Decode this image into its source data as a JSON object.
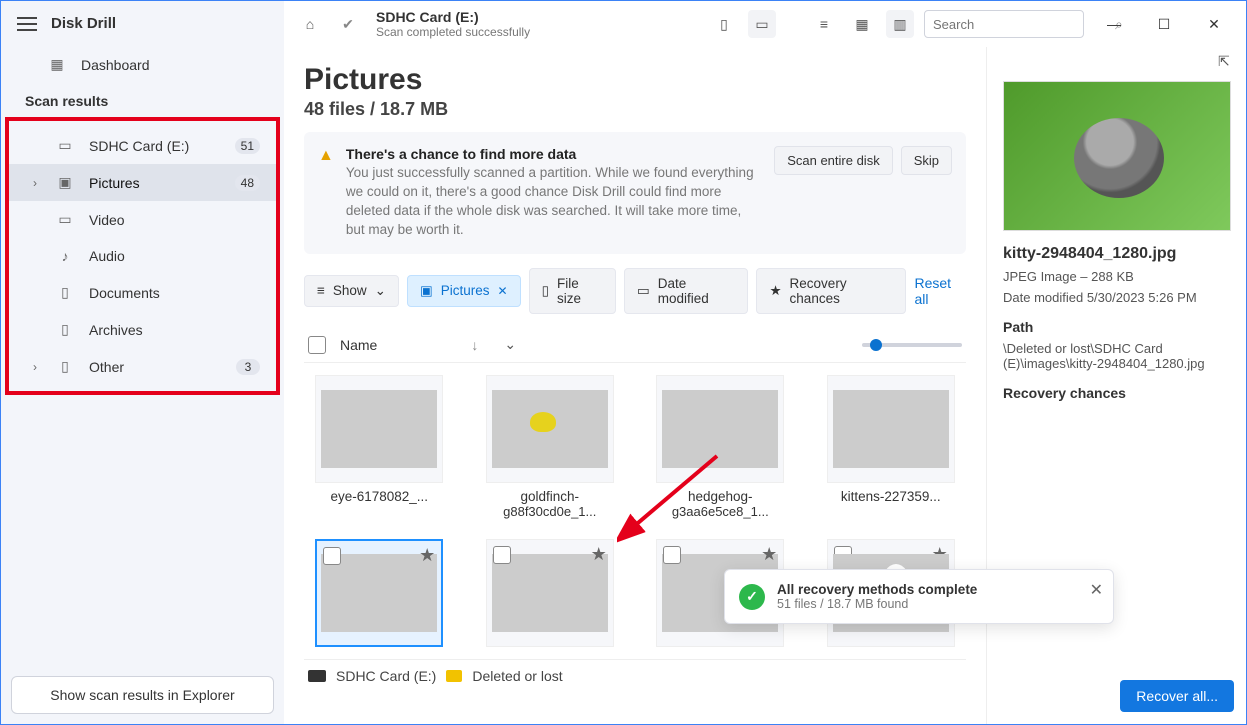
{
  "app": {
    "name": "Disk Drill"
  },
  "sidebar": {
    "dashboard": "Dashboard",
    "section": "Scan results",
    "items": [
      {
        "label": "SDHC Card (E:)",
        "badge": "51"
      },
      {
        "label": "Pictures",
        "badge": "48"
      },
      {
        "label": "Video"
      },
      {
        "label": "Audio"
      },
      {
        "label": "Documents"
      },
      {
        "label": "Archives"
      },
      {
        "label": "Other",
        "badge": "3"
      }
    ],
    "explorer_btn": "Show scan results in Explorer"
  },
  "titlebar": {
    "title": "SDHC Card (E:)",
    "subtitle": "Scan completed successfully",
    "search_placeholder": "Search"
  },
  "page": {
    "title": "Pictures",
    "subtitle": "48 files / 18.7 MB"
  },
  "notice": {
    "title": "There's a chance to find more data",
    "text": "You just successfully scanned a partition. While we found everything we could on it, there's a good chance Disk Drill could find more deleted data if the whole disk was searched. It will take more time, but may be worth it.",
    "scan_btn": "Scan entire disk",
    "skip_btn": "Skip"
  },
  "filters": {
    "show": "Show",
    "pictures": "Pictures",
    "filesize": "File size",
    "datemod": "Date modified",
    "recovery": "Recovery chances",
    "reset": "Reset all"
  },
  "listhead": {
    "name": "Name"
  },
  "thumbs": [
    {
      "cap1": "eye-6178082_..."
    },
    {
      "cap1": "goldfinch-",
      "cap2": "g88f30cd0e_1..."
    },
    {
      "cap1": "hedgehog-",
      "cap2": "g3aa6e5ce8_1..."
    },
    {
      "cap1": "kittens-227359..."
    }
  ],
  "breadcrumb": {
    "a": "SDHC Card (E:)",
    "b": "Deleted or lost"
  },
  "rightpanel": {
    "filename": "kitty-2948404_1280.jpg",
    "type": "JPEG Image – 288 KB",
    "modified": "Date modified 5/30/2023 5:26 PM",
    "path_h": "Path",
    "path": "\\Deleted or lost\\SDHC Card (E)\\images\\kitty-2948404_1280.jpg",
    "rc_h": "Recovery chances"
  },
  "toast": {
    "title": "All recovery methods complete",
    "sub": "51 files / 18.7 MB found"
  },
  "footer": {
    "recover": "Recover all..."
  }
}
